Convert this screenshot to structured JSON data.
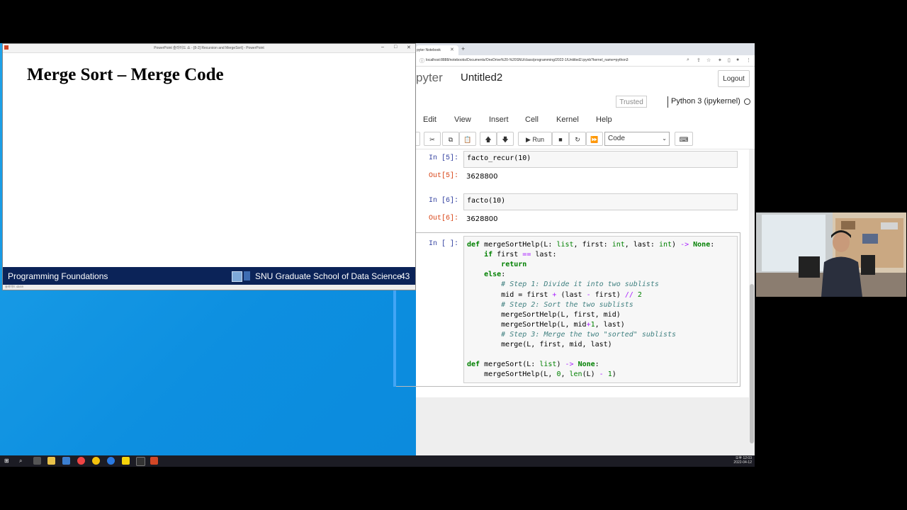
{
  "powerpoint": {
    "title_bar": "PowerPoint 슬라이드 쇼 - [8-2] Recursion and MergeSort] - PowerPoint",
    "slide_title": "Merge Sort – Merge Code",
    "footer_left": "Programming Foundations",
    "footer_right": "SNU Graduate School of Data Science",
    "page_number": "43",
    "status_text": "슬라이드 43/49"
  },
  "browser": {
    "tab_label": "pyter Notebook",
    "url": "localhost:8888/notebooks/Documents/OneDrive%20-%20SNU/class/programming/2022-1/Untitled2.ipynb?kernel_name=python3"
  },
  "jupyter": {
    "logo_text": "pyter",
    "notebook_name": "Untitled2",
    "logout_label": "Logout",
    "trusted_label": "Trusted",
    "kernel_label": "Python 3 (ipykernel)",
    "menu": [
      "Edit",
      "View",
      "Insert",
      "Cell",
      "Kernel",
      "Help"
    ],
    "run_label": "Run",
    "cell_type": "Code",
    "cells": [
      {
        "in_prompt": "In [5]:",
        "code": "facto_recur(10)",
        "out_prompt": "Out[5]:",
        "output": "3628800"
      },
      {
        "in_prompt": "In [6]:",
        "code": "facto(10)",
        "out_prompt": "Out[6]:",
        "output": "3628800"
      }
    ],
    "active_prompt": "In [ ]:",
    "code_lines": [
      "def mergeSortHelp(L: list, first: int, last: int) -> None:",
      "    if first == last:",
      "        return",
      "    else:",
      "        # Step 1: Divide it into two sublists",
      "        mid = first + (last - first) // 2",
      "        # Step 2: Sort the two sublists",
      "        mergeSortHelp(L, first, mid)",
      "        mergeSortHelp(L, mid+1, last)",
      "        # Step 3: Merge the two \"sorted\" sublists",
      "        merge(L, first, mid, last)",
      "",
      "def mergeSort(L: list) -> None:",
      "    mergeSortHelp(L, 0, len(L) - 1)"
    ]
  },
  "taskbar": {
    "clock_line1": "오후 12:03",
    "clock_line2": "2022-04-12"
  }
}
